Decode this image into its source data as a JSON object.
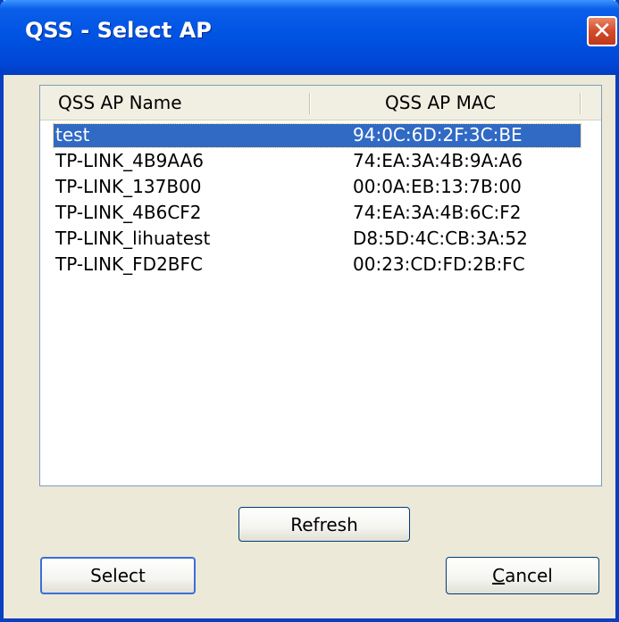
{
  "window": {
    "title": "QSS - Select AP",
    "close_glyph": "✕"
  },
  "list": {
    "columns": [
      "QSS AP Name",
      "QSS AP MAC"
    ],
    "rows": [
      {
        "name": "test",
        "mac": "94:0C:6D:2F:3C:BE",
        "selected": true
      },
      {
        "name": "TP-LINK_4B9AA6",
        "mac": "74:EA:3A:4B:9A:A6"
      },
      {
        "name": "TP-LINK_137B00",
        "mac": "00:0A:EB:13:7B:00"
      },
      {
        "name": "TP-LINK_4B6CF2",
        "mac": "74:EA:3A:4B:6C:F2"
      },
      {
        "name": "TP-LINK_lihuatest",
        "mac": "D8:5D:4C:CB:3A:52"
      },
      {
        "name": "TP-LINK_FD2BFC",
        "mac": "00:23:CD:FD:2B:FC"
      }
    ]
  },
  "buttons": {
    "refresh": "Refresh",
    "select": "Select",
    "cancel_mnemonic": "C",
    "cancel_rest": "ancel"
  },
  "colors": {
    "titlebar": "#0054e3",
    "selection": "#316ac5",
    "close_button": "#d24b2a"
  }
}
